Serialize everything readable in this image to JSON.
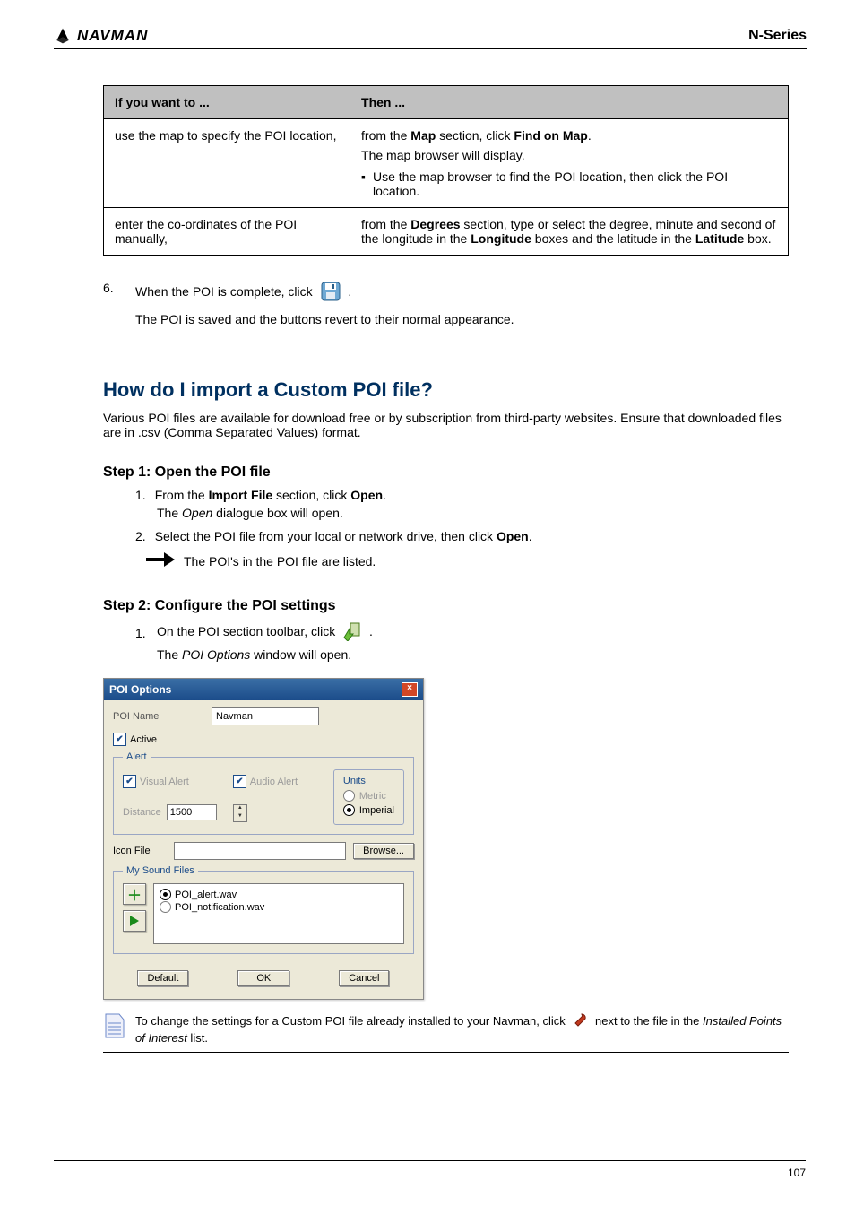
{
  "header": {
    "brand": "NAVMAN",
    "series": "N-Series"
  },
  "table": {
    "header_left": "If you want to ...",
    "header_right": "Then ...",
    "rows": [
      {
        "left_intro": "use the map to specify the POI location,",
        "right_a": "from the ",
        "right_b": "Map",
        "right_c": " section, click ",
        "right_d": "Find on Map",
        "right_e": ".",
        "right_line2": "The map browser will display.",
        "right_bullet": "Use the map browser to find the POI location, then click the POI location."
      },
      {
        "left_intro": "enter the co-ordinates of the POI manually,",
        "right_a": "from the ",
        "right_b": "Degrees",
        "right_c": " section, type or select the degree, minute and second of the longitude in the ",
        "right_d": "Longitude",
        "right_e": " boxes and the latitude in the ",
        "right_f": "Latitude",
        "right_g": " box."
      }
    ]
  },
  "step6": {
    "num": "6.",
    "line1a": "When the POI is complete, click ",
    "line1b": ".",
    "line2": "The POI is saved and the buttons revert to their normal appearance.",
    "icon_title": "save"
  },
  "heading_import": "How do I import a Custom POI file?",
  "import_intro": "Various POI files are available for download free or by subscription from third-party websites. Ensure that downloaded files are in .csv (Comma Separated Values) format.",
  "step1": {
    "header": "Step 1: Open the POI file",
    "list": [
      {
        "num": "1.",
        "a": "From the ",
        "b": "Import File",
        "c": " section, click ",
        "d": "Open",
        "e": "."
      },
      {
        "num": "",
        "a": "The ",
        "b": "Open",
        "c": " dialogue box will open."
      },
      {
        "num": "2.",
        "a": "Select the POI file from your local or network drive, then click ",
        "b": "Open",
        "c": "."
      },
      {
        "num": "",
        "arrow": true,
        "a": "The POI's in the POI file are listed."
      }
    ]
  },
  "step2": {
    "header": "Step 2: Configure the POI settings",
    "line_a": "On the POI section toolbar, click ",
    "line_b": ".",
    "line_c": "The POI Options window will open.",
    "icon_title": "options"
  },
  "dialog": {
    "title": "POI Options",
    "poi_name_label": "POI Name",
    "poi_name_value": "Navman",
    "active_label": "Active",
    "alert_legend": "Alert",
    "visual_alert": "Visual Alert",
    "audio_alert": "Audio Alert",
    "distance_label": "Distance",
    "distance_value": "1500",
    "units_legend": "Units",
    "metric": "Metric",
    "imperial": "Imperial",
    "icon_file_label": "Icon File",
    "browse": "Browse...",
    "sound_legend": "My Sound Files",
    "sound_files": [
      "POI_alert.wav",
      "POI_notification.wav"
    ],
    "default": "Default",
    "ok": "OK",
    "cancel": "Cancel"
  },
  "notes": {
    "line1a": "To change the settings for a Custom POI file already installed to your Navman, click ",
    "line1b": " next to the file in the ",
    "line1c": "Installed Points of Interest",
    "line1d": " list.",
    "line1link": "Installed Points of Interest"
  },
  "footer": {
    "page": "107"
  }
}
